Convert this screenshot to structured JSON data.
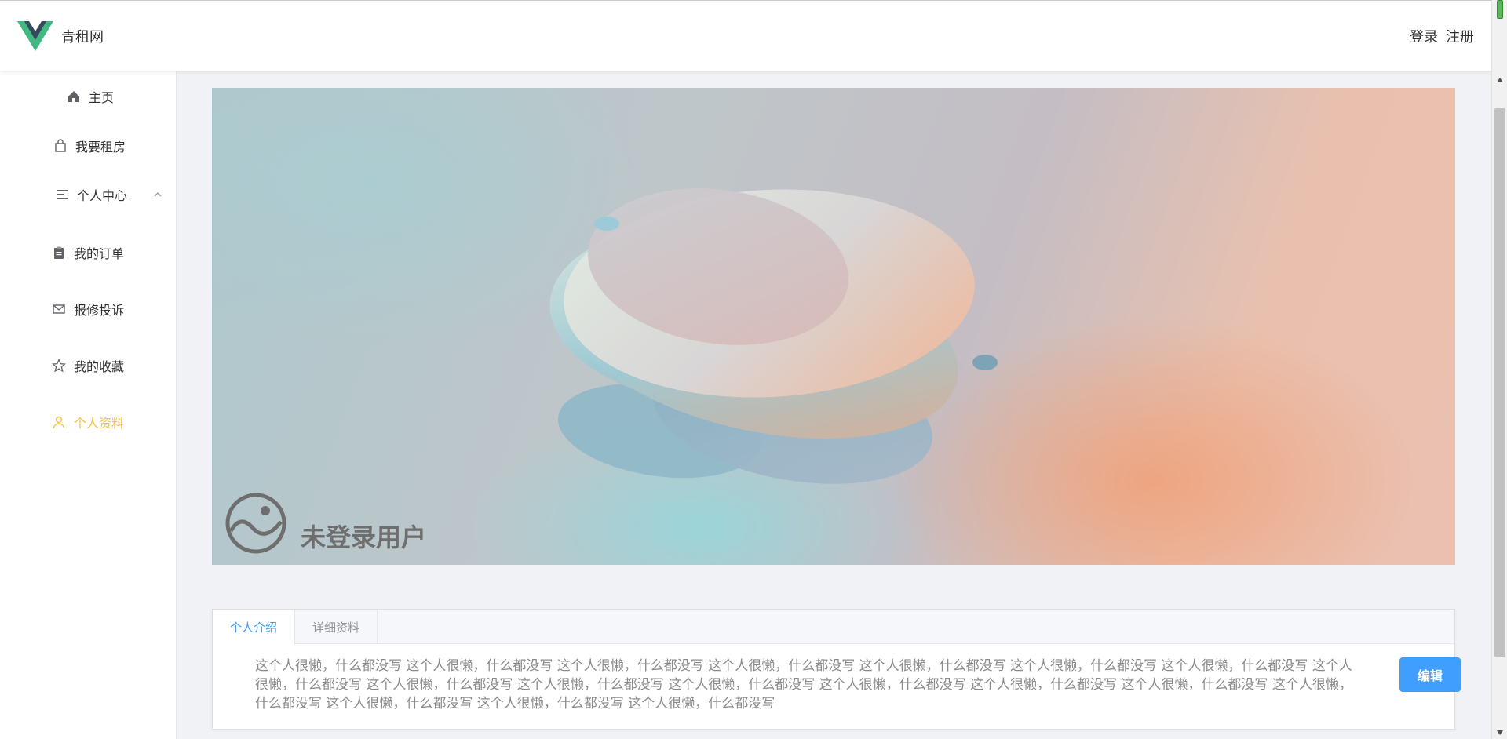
{
  "app": {
    "name": "青租网"
  },
  "header": {
    "login_label": "登录",
    "register_label": "注册"
  },
  "sidebar": {
    "items": [
      {
        "label": "主页",
        "icon": "home-icon"
      },
      {
        "label": "我要租房",
        "icon": "bag-icon"
      },
      {
        "label": "个人中心",
        "icon": "menu-icon"
      },
      {
        "label": "我的订单",
        "icon": "clipboard-icon"
      },
      {
        "label": "报修投诉",
        "icon": "mail-icon"
      },
      {
        "label": "我的收藏",
        "icon": "star-icon"
      },
      {
        "label": "个人资料",
        "icon": "user-icon"
      }
    ],
    "active_color": "#f5c342"
  },
  "banner": {
    "username": "未登录用户"
  },
  "profile": {
    "tabs": [
      "个人介绍",
      "详细资料"
    ],
    "intro_text": "这个人很懒，什么都没写 这个人很懒，什么都没写 这个人很懒，什么都没写 这个人很懒，什么都没写 这个人很懒，什么都没写 这个人很懒，什么都没写 这个人很懒，什么都没写 这个人很懒，什么都没写 这个人很懒，什么都没写 这个人很懒，什么都没写 这个人很懒，什么都没写 这个人很懒，什么都没写 这个人很懒，什么都没写 这个人很懒，什么都没写 这个人很懒，什么都没写 这个人很懒，什么都没写 这个人很懒，什么都没写 这个人很懒，什么都没写",
    "edit_label": "编辑"
  },
  "colors": {
    "primary": "#409eff",
    "brand_green": "#42b883",
    "brand_dark": "#35495e"
  }
}
